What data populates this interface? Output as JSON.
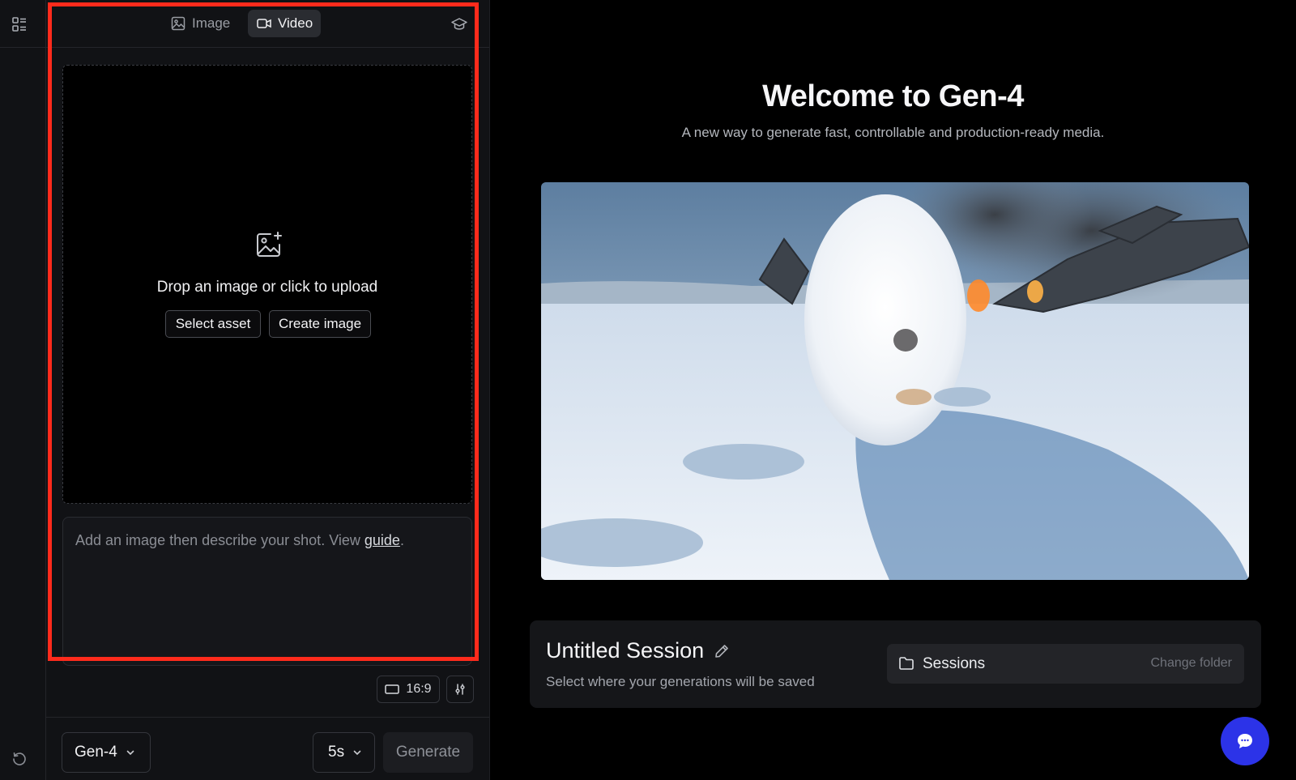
{
  "tabs": {
    "image_label": "Image",
    "video_label": "Video"
  },
  "dropzone": {
    "text": "Drop an image or click to upload",
    "select_asset_label": "Select asset",
    "create_image_label": "Create image"
  },
  "prompt": {
    "placeholder": "Add an image then describe your shot. View ",
    "guide_link": "guide",
    "suffix": "."
  },
  "controls": {
    "aspect_ratio": "16:9",
    "model": "Gen-4",
    "duration": "5s",
    "generate_label": "Generate"
  },
  "welcome": {
    "title": "Welcome to Gen-4",
    "subtitle": "A new way to generate fast, controllable and production-ready media."
  },
  "session": {
    "title": "Untitled Session",
    "subtitle": "Select where your generations will be saved",
    "folder_name": "Sessions",
    "change_folder_label": "Change folder"
  },
  "colors": {
    "highlight": "#ff2b1c",
    "chat_button": "#2c33e8",
    "background": "#000000",
    "panel": "#111215"
  },
  "icons": {
    "rail_top": "layout-grid-icon",
    "rail_bottom": "history-icon",
    "learn": "graduation-cap-icon",
    "upload": "image-plus-icon",
    "session_edit": "pencil-icon",
    "folder": "folder-icon",
    "chat": "chat-bubble-icon"
  }
}
